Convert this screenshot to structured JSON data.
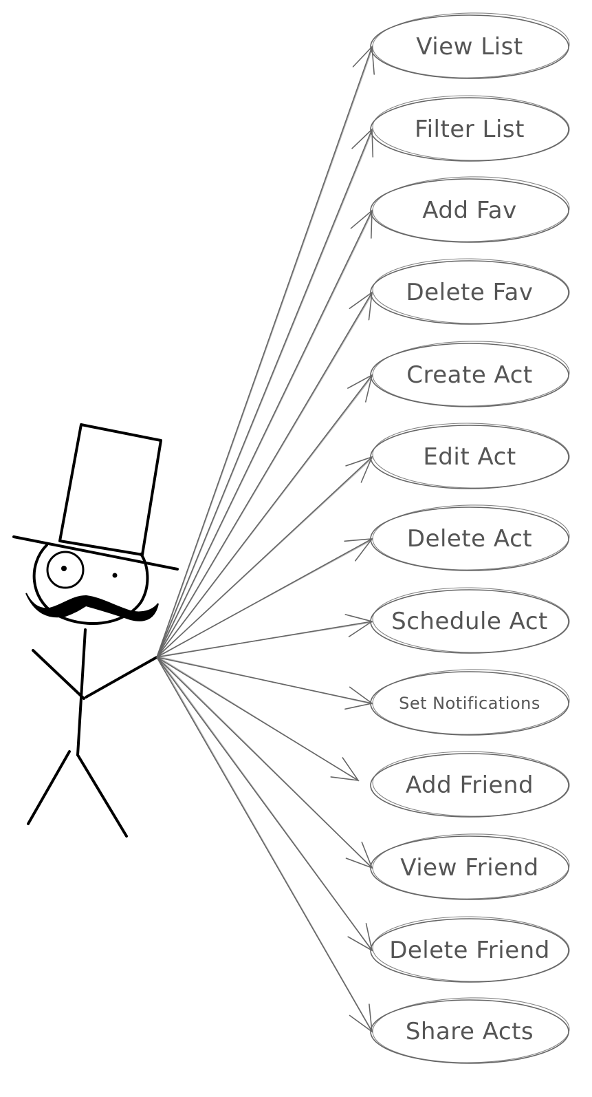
{
  "actor": {
    "icon": "stick-figure-with-top-hat-monocle-mustache-icon",
    "label": ""
  },
  "use_cases": [
    {
      "label": "View List"
    },
    {
      "label": "Filter List"
    },
    {
      "label": "Add Fav"
    },
    {
      "label": "Delete Fav"
    },
    {
      "label": "Create Act"
    },
    {
      "label": "Edit Act"
    },
    {
      "label": "Delete Act"
    },
    {
      "label": "Schedule Act"
    },
    {
      "label": "Set Notifications"
    },
    {
      "label": "Add Friend"
    },
    {
      "label": "View Friend"
    },
    {
      "label": "Delete Friend"
    },
    {
      "label": "Share Acts"
    }
  ],
  "colors": {
    "line": "#666666",
    "text": "#555555",
    "actor": "#000000",
    "background": "#ffffff"
  }
}
